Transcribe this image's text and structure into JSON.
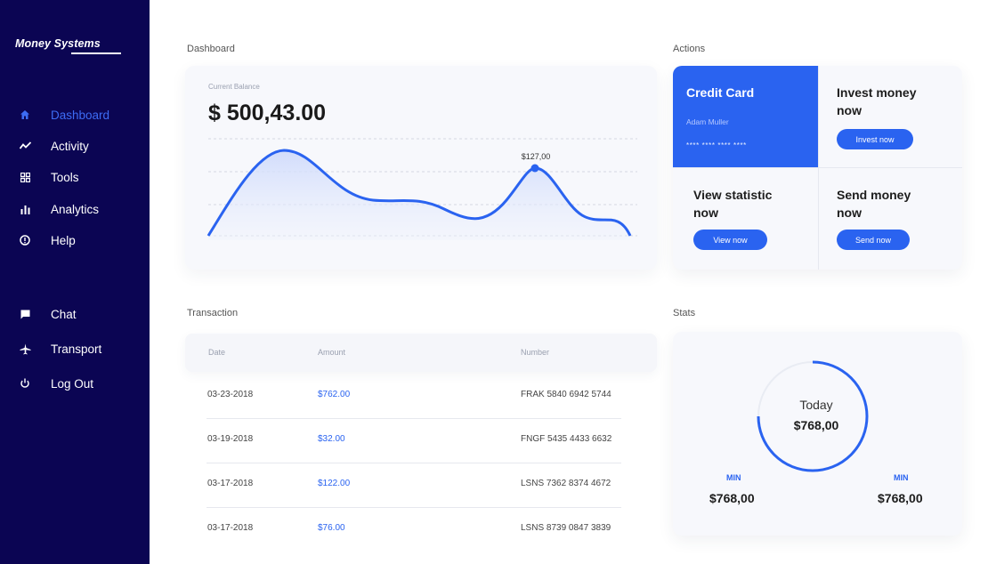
{
  "brand": "Money Systems",
  "nav": [
    {
      "label": "Dashboard",
      "icon": "home-icon",
      "active": true
    },
    {
      "label": "Activity",
      "icon": "activity-icon",
      "active": false
    },
    {
      "label": "Tools",
      "icon": "tools-icon",
      "active": false
    },
    {
      "label": "Analytics",
      "icon": "analytics-icon",
      "active": false
    },
    {
      "label": "Help",
      "icon": "help-icon",
      "active": false
    }
  ],
  "nav2": [
    {
      "label": "Chat",
      "icon": "chat-icon"
    },
    {
      "label": "Transport",
      "icon": "airplane-icon"
    },
    {
      "label": "Log Out",
      "icon": "power-icon"
    }
  ],
  "sections": {
    "dashboard": "Dashboard",
    "actions": "Actions",
    "transaction": "Transaction",
    "stats": "Stats"
  },
  "balance": {
    "caption": "Current Balance",
    "value": "$ 500,43.00",
    "point_label": "$127,00"
  },
  "actions": {
    "credit_title": "Credit Card",
    "credit_name": "Adam Muller",
    "credit_number": "**** **** **** ****",
    "invest_title_1": "Invest money",
    "invest_title_2": "now",
    "invest_btn": "Invest now",
    "view_title_1": "View statistic",
    "view_title_2": "now",
    "view_btn": "View now",
    "send_title_1": "Send money",
    "send_title_2": "now",
    "send_btn": "Send now"
  },
  "transactions": {
    "headers": [
      "Date",
      "Amount",
      "Number"
    ],
    "rows": [
      {
        "date": "03-23-2018",
        "amount": "$762.00",
        "number": "FRAK 5840 6942 5744"
      },
      {
        "date": "03-19-2018",
        "amount": "$32.00",
        "number": "FNGF 5435 4433 6632"
      },
      {
        "date": "03-17-2018",
        "amount": "$122.00",
        "number": "LSNS 7362 8374 4672"
      },
      {
        "date": "03-17-2018",
        "amount": "$76.00",
        "number": "LSNS 8739 0847 3839"
      }
    ]
  },
  "stats": {
    "today_label": "Today",
    "today_value": "$768,00",
    "left_label": "MIN",
    "left_value": "$768,00",
    "right_label": "MIN",
    "right_value": "$768,00"
  },
  "colors": {
    "sidebar": "#0b0553",
    "accent": "#2a63f0"
  }
}
